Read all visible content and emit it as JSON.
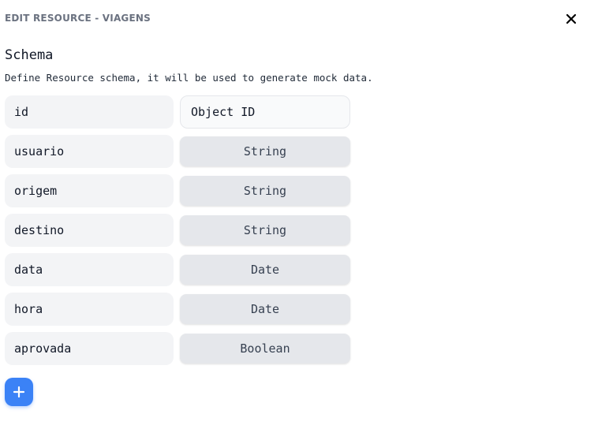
{
  "modal": {
    "title": "EDIT RESOURCE - VIAGENS"
  },
  "schema": {
    "heading": "Schema",
    "description": "Define Resource schema, it will be used to generate mock data.",
    "fields": [
      {
        "name": "id",
        "type": "Object ID"
      },
      {
        "name": "usuario",
        "type": "String"
      },
      {
        "name": "origem",
        "type": "String"
      },
      {
        "name": "destino",
        "type": "String"
      },
      {
        "name": "data",
        "type": "Date"
      },
      {
        "name": "hora",
        "type": "Date"
      },
      {
        "name": "aprovada",
        "type": "Boolean"
      }
    ]
  },
  "icons": {
    "close": "close-icon",
    "add": "plus-icon"
  },
  "colors": {
    "accent": "#3b82f6",
    "field_background": "#f3f4f6",
    "type_background": "#e5e7eb",
    "title_text": "#6b7280"
  }
}
